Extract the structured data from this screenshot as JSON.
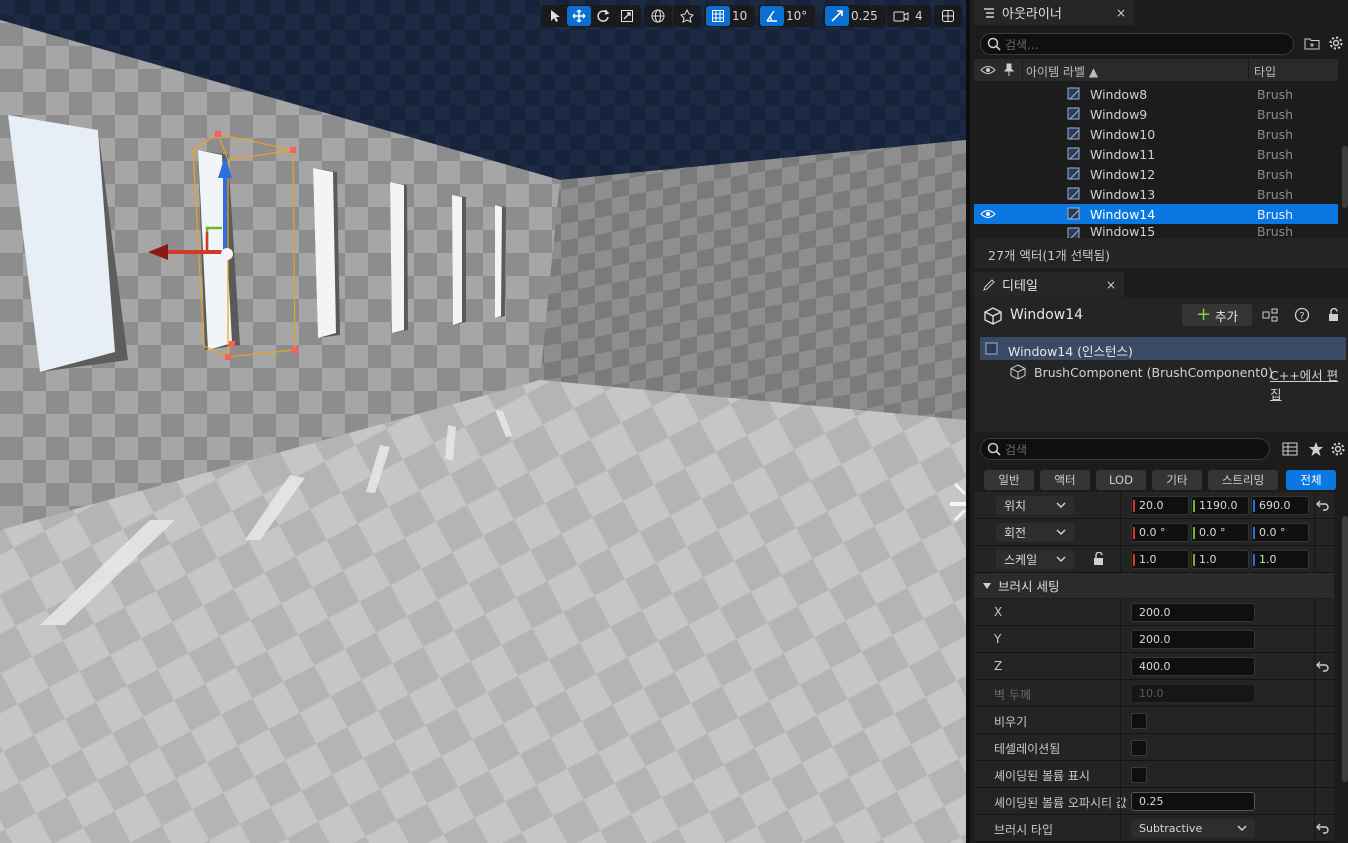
{
  "viewport": {
    "toolbar": {
      "select_icon": "select-arrow",
      "translate_icon": "move-arrows",
      "rotate_icon": "rotate",
      "scale_icon": "scale",
      "world_local_icon": "globe",
      "surface_snap_icon": "surface-snap",
      "grid_snap_value": "10",
      "rotation_snap_value": "10°",
      "scale_snap_value": "0.25",
      "camera_speed_value": "4",
      "layout_icon": "viewport-layout"
    }
  },
  "outliner": {
    "tab_title": "아웃라이너",
    "close": "×",
    "search_placeholder": "검색...",
    "header": {
      "item_label": "아이템 라벨 ▲",
      "type": "타입"
    },
    "rows": [
      {
        "name": "Window8",
        "type": "Brush"
      },
      {
        "name": "Window9",
        "type": "Brush"
      },
      {
        "name": "Window10",
        "type": "Brush"
      },
      {
        "name": "Window11",
        "type": "Brush"
      },
      {
        "name": "Window12",
        "type": "Brush"
      },
      {
        "name": "Window13",
        "type": "Brush"
      },
      {
        "name": "Window14",
        "type": "Brush"
      },
      {
        "name": "Window15",
        "type": "Brush"
      }
    ],
    "status": "27개 액터(1개 선택됨)"
  },
  "details": {
    "tab_title": "디테일",
    "close": "×",
    "actor_name": "Window14",
    "add_button": "추가",
    "instance_label": "Window14 (인스턴스)",
    "component_label": "BrushComponent (BrushComponent0)",
    "edit_cpp_link": "C++에서 편집",
    "search_placeholder": "검색",
    "filter_tabs": [
      "일반",
      "액터",
      "LOD",
      "기타",
      "스트리밍",
      "전체"
    ],
    "transform": {
      "location_label": "위치",
      "location": [
        "20.0",
        "1190.0",
        "690.0"
      ],
      "rotation_label": "회전",
      "rotation": [
        "0.0 °",
        "0.0 °",
        "0.0 °"
      ],
      "scale_label": "스케일",
      "scale": [
        "1.0",
        "1.0",
        "1.0"
      ]
    },
    "brush_settings": {
      "section_title": "브러시 세팅",
      "x_label": "X",
      "x": "200.0",
      "y_label": "Y",
      "y": "200.0",
      "z_label": "Z",
      "z": "400.0",
      "wall_thickness_label": "벽 두께",
      "wall_thickness": "10.0",
      "hollow_label": "비우기",
      "tessellated_label": "테셀레이션됨",
      "display_shaded_label": "셰이딩된 볼륨 표시",
      "shaded_opacity_label": "셰이딩된 볼륨 오파시티 값",
      "shaded_opacity": "0.25",
      "brush_type_label": "브러시 타입",
      "brush_type": "Subtractive"
    }
  },
  "colors": {
    "accent": "#0a78e0",
    "axis_x": "#d33a2c",
    "axis_y": "#6cb52d",
    "axis_z": "#2e6fe0"
  }
}
